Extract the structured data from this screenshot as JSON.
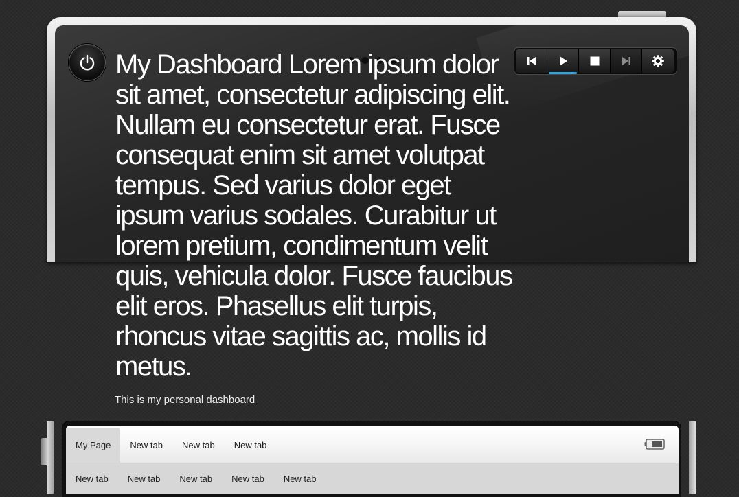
{
  "header": {
    "headline": "My Dashboard Lorem ipsum dolor sit amet, consectetur adipiscing elit. Nullam eu consectetur erat. Fusce consequat enim sit amet volutpat tempus. Sed varius dolor eget ipsum varius sodales. Curabitur ut lorem pretium, condimentum velit quis, vehicula dolor. Fusce faucibus elit eros. Phasellus elit turpis, rhoncus vitae sagittis ac, mollis id metus.",
    "tagline": "This is my personal dashboard"
  },
  "icons": {
    "power": "power-icon",
    "battery": "battery-icon"
  },
  "media_controls": [
    {
      "name": "previous",
      "icon": "skip-previous-icon",
      "active": false
    },
    {
      "name": "play",
      "icon": "play-icon",
      "active": true
    },
    {
      "name": "stop",
      "icon": "stop-icon",
      "active": false
    },
    {
      "name": "next",
      "icon": "skip-next-icon",
      "active": false
    },
    {
      "name": "settings",
      "icon": "gear-icon",
      "active": false
    }
  ],
  "page_indicator": {
    "pages": 4
  },
  "tabs": {
    "row1": [
      {
        "label": "My Page",
        "selected": true
      },
      {
        "label": "New tab",
        "selected": false
      },
      {
        "label": "New tab",
        "selected": false
      },
      {
        "label": "New tab",
        "selected": false
      }
    ],
    "row2": [
      {
        "label": "New tab"
      },
      {
        "label": "New tab"
      },
      {
        "label": "New tab"
      },
      {
        "label": "New tab"
      },
      {
        "label": "New tab"
      }
    ]
  },
  "colors": {
    "accent": "#2aa7e0",
    "background": "#2b2b2b",
    "screen": "#262626",
    "text": "#ffffff"
  }
}
